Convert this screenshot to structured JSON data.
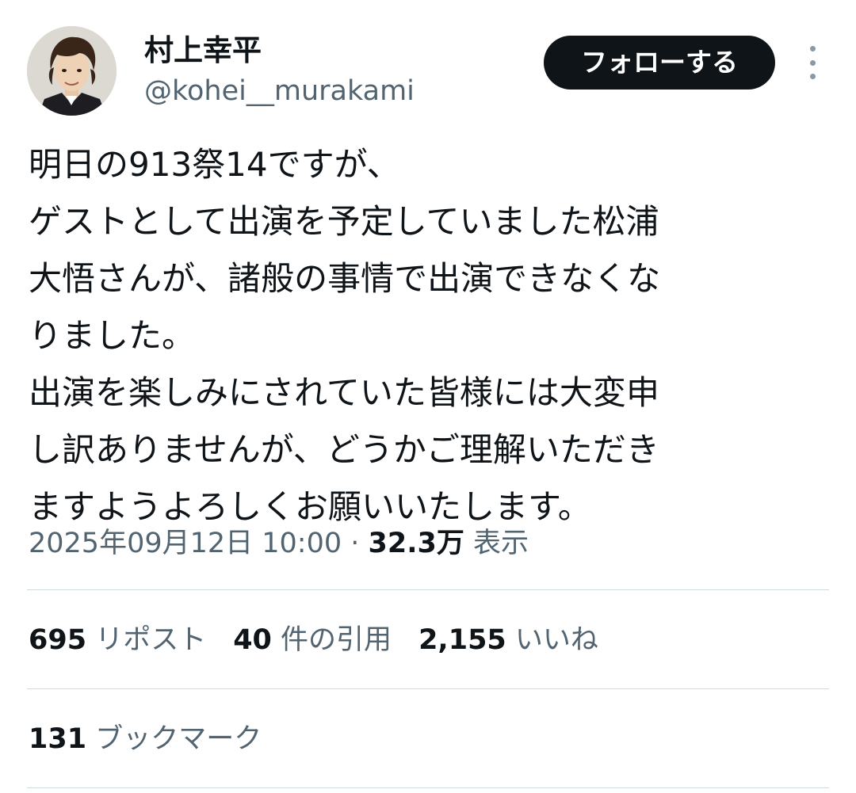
{
  "author": {
    "display_name": "村上幸平",
    "handle": "@kohei__murakami"
  },
  "follow_button_label": "フォローする",
  "more_icon": "more-vertical-icon",
  "tweet": {
    "lines": [
      "明日の913祭14ですが、",
      "ゲストとして出演を予定していました松浦",
      "大悟さんが、諸般の事情で出演できなくな",
      "りました。",
      "出演を楽しみにされていた皆様には大変申",
      "し訳ありませんが、どうかご理解いただき",
      "ますようよろしくお願いいたします。"
    ],
    "timestamp": "2025年09月12日 10:00",
    "separator": " · ",
    "views_count": "32.3万",
    "views_label": " 表示"
  },
  "stats": {
    "reposts": {
      "count": "695",
      "label": " リポスト"
    },
    "quotes": {
      "count": "40",
      "label": " 件の引用"
    },
    "likes": {
      "count": "2,155",
      "label": " いいね"
    },
    "bookmarks": {
      "count": "131",
      "label": " ブックマーク"
    }
  },
  "colors": {
    "text_primary": "#0f1419",
    "text_secondary": "#536471",
    "divider": "#cfd9de",
    "button_bg": "#0f1419",
    "button_text": "#ffffff"
  }
}
